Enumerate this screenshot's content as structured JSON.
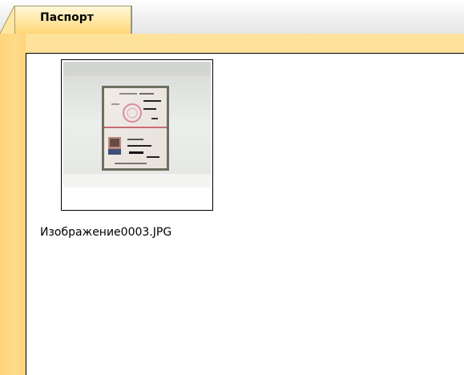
{
  "tabs": [
    {
      "label": "Паспорт",
      "active": true
    }
  ],
  "files": [
    {
      "name": "Изображение0003.JPG",
      "icon": "passport-photo-thumbnail"
    }
  ],
  "colors": {
    "frame": "#ffd37a",
    "tab_active": "#ffe7a3",
    "background": "#ffffff"
  }
}
